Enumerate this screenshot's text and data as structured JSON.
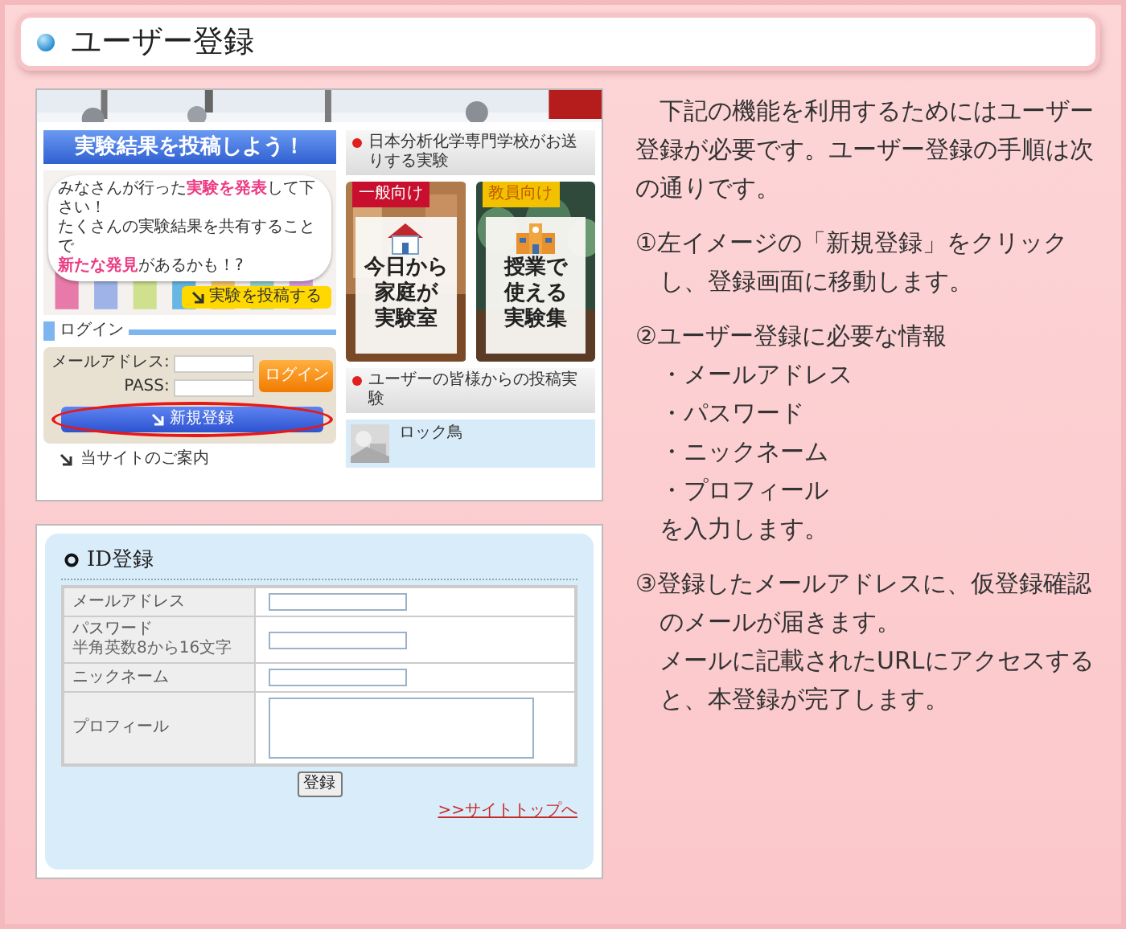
{
  "header": {
    "title": "ユーザー登録"
  },
  "site_screenshot": {
    "post_banner": {
      "heading": "実験結果を投稿しよう！",
      "bubble_lines": [
        "みなさんが行った**実験を発表**して下さい！",
        "たくさんの実験結果を共有することで",
        "**新たな発見**があるかも！?"
      ],
      "button": "実験を投稿する"
    },
    "login": {
      "heading": "ログイン",
      "email_label": "メールアドレス:",
      "pass_label": "PASS:",
      "login_button": "ログイン",
      "register_button": "新規登録",
      "register_highlighted": true
    },
    "guide_link": "当サイトのご案内",
    "experiments": {
      "heading": "日本分析化学専門学校がお送りする実験",
      "cards": [
        {
          "tag": "一般向け",
          "color": "#c8102e",
          "title_lines": [
            "今日から",
            "家庭が",
            "実験室"
          ]
        },
        {
          "tag": "教員向け",
          "color": "#f2c200",
          "title_lines": [
            "授業で",
            "使える",
            "実験集"
          ]
        }
      ]
    },
    "posts": {
      "heading": "ユーザーの皆様からの投稿実験",
      "items": [
        {
          "title": "ロック鳥"
        }
      ]
    }
  },
  "form_screenshot": {
    "heading": "ID登録",
    "rows": [
      {
        "label": "メールアドレス",
        "kind": "input"
      },
      {
        "label": "パスワード",
        "note": "半角英数8から16文字",
        "kind": "input"
      },
      {
        "label": "ニックネーム",
        "kind": "input"
      },
      {
        "label": "プロフィール",
        "kind": "textarea"
      }
    ],
    "submit": "登録",
    "top_link": ">>サイトトップへ"
  },
  "instructions": {
    "intro": "下記の機能を利用するためにはユーザー登録が必要です。ユーザー登録の手順は次の通りです。",
    "steps": [
      {
        "text": "①左イメージの「新規登録」をクリックし、登録画面に移動します。"
      },
      {
        "text": "②ユーザー登録に必要な情報",
        "items": [
          "・メールアドレス",
          "・パスワード",
          "・ニックネーム",
          "・プロフィール"
        ],
        "after": "を入力します。"
      },
      {
        "text": "③登録したメールアドレスに、仮登録確認のメールが届きます。",
        "more": "メールに記載されたURLにアクセスすると、本登録が完了します。"
      }
    ]
  }
}
